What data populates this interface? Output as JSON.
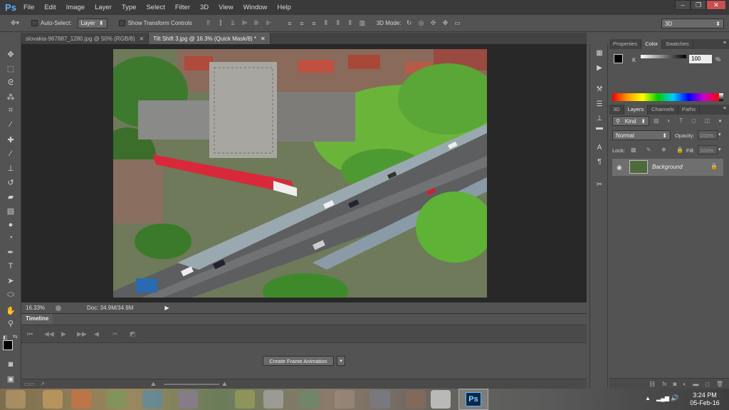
{
  "app": {
    "logo": "Ps"
  },
  "menu": [
    "File",
    "Edit",
    "Image",
    "Layer",
    "Type",
    "Select",
    "Filter",
    "3D",
    "View",
    "Window",
    "Help"
  ],
  "options_bar": {
    "auto_select_label": "Auto-Select:",
    "auto_select_value": "Layer",
    "transform_label": "Show Transform Controls",
    "mode_3d_label": "3D Mode:",
    "workspace": "3D"
  },
  "tabs": [
    {
      "label": "slovakia-967887_1280.jpg @ 50% (RGB/8)",
      "active": false
    },
    {
      "label": "Tilt Shift 3.jpg @ 16.3% (Quick Mask/8) *",
      "active": true
    }
  ],
  "status": {
    "zoom": "16.33%",
    "doc": "Doc: 34.9M/34.9M"
  },
  "timeline": {
    "title": "Timeline",
    "create_button": "Create Frame Animation"
  },
  "panels": {
    "top_tabs": [
      "Properties",
      "Color",
      "Swatches"
    ],
    "color": {
      "channel": "K",
      "value": "100",
      "unit": "%"
    },
    "layer_tabs": [
      "3D",
      "Layers",
      "Channels",
      "Paths"
    ],
    "kind_label": "Kind",
    "blend_mode": "Normal",
    "opacity_label": "Opacity:",
    "opacity_value": "100%",
    "lock_label": "Lock:",
    "fill_label": "Fill:",
    "fill_value": "100%",
    "layer_name": "Background"
  },
  "taskbar": {
    "time": "3:24 PM",
    "date": "05-Feb-16",
    "ps_label": "Ps"
  },
  "colors": {
    "accent": "#5ab2ff",
    "panel_bg": "#535353",
    "canvas_bg": "#282828"
  }
}
